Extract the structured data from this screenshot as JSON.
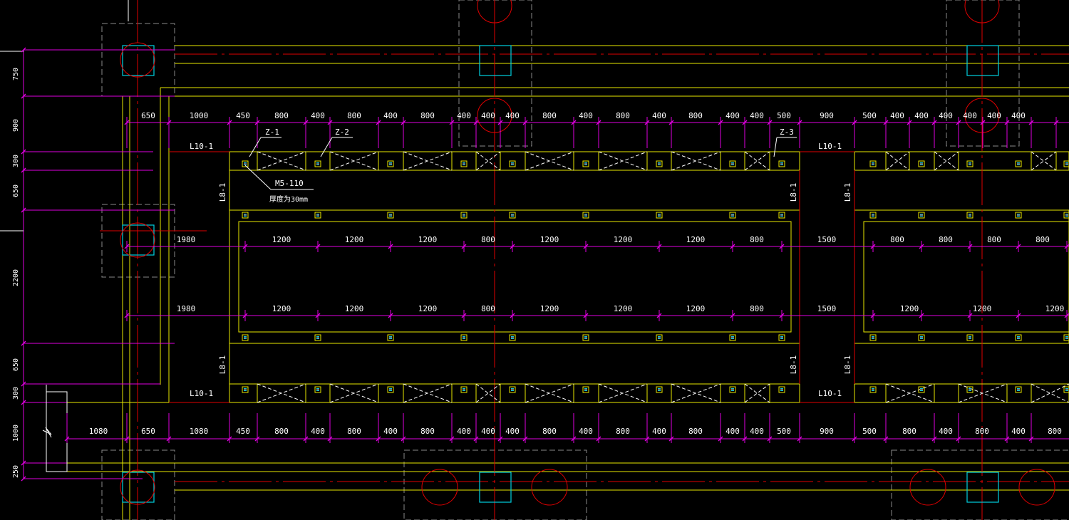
{
  "colors": {
    "background": "#000000",
    "dimension": "#e000e0",
    "wall": "#e8e800",
    "axis": "#e00000",
    "column": "#00d0e0",
    "foundation": "#8a8a8a",
    "text": "#ffffff"
  },
  "top_dims": [
    "650",
    "1000",
    "450",
    "800",
    "400",
    "800",
    "400",
    "800",
    "400",
    "400",
    "400",
    "800",
    "400",
    "800",
    "400",
    "800",
    "400",
    "400",
    "500",
    "900",
    "500",
    "400",
    "400",
    "400",
    "400",
    "400",
    "400"
  ],
  "bottom_dims": [
    "1080",
    "650",
    "1080",
    "450",
    "800",
    "400",
    "800",
    "400",
    "800",
    "400",
    "400",
    "400",
    "800",
    "400",
    "800",
    "400",
    "800",
    "400",
    "400",
    "500",
    "900",
    "500",
    "800",
    "400",
    "800",
    "400",
    "800"
  ],
  "row1_dims": [
    "1980",
    "1200",
    "1200",
    "1200",
    "800",
    "1200",
    "1200",
    "1200",
    "800",
    "1500",
    "800",
    "800",
    "800",
    "800"
  ],
  "row2_dims": [
    "1980",
    "1200",
    "1200",
    "1200",
    "800",
    "1200",
    "1200",
    "1200",
    "800",
    "1500",
    "1200",
    "1200",
    "1200"
  ],
  "left_dims": [
    "750",
    "900",
    "300",
    "650",
    "2200",
    "650",
    "300",
    "1000",
    "250"
  ],
  "labels": {
    "beam_l10_top_left": "L10-1",
    "beam_l10_top_right": "L10-1",
    "beam_l10_bot_left": "L10-1",
    "beam_l10_bot_right": "L10-1",
    "beam_l8": "L8-1",
    "z1": "Z-1",
    "z2": "Z-2",
    "z3": "Z-3",
    "mortar": "M5-110",
    "note": "厚度为30mm"
  }
}
